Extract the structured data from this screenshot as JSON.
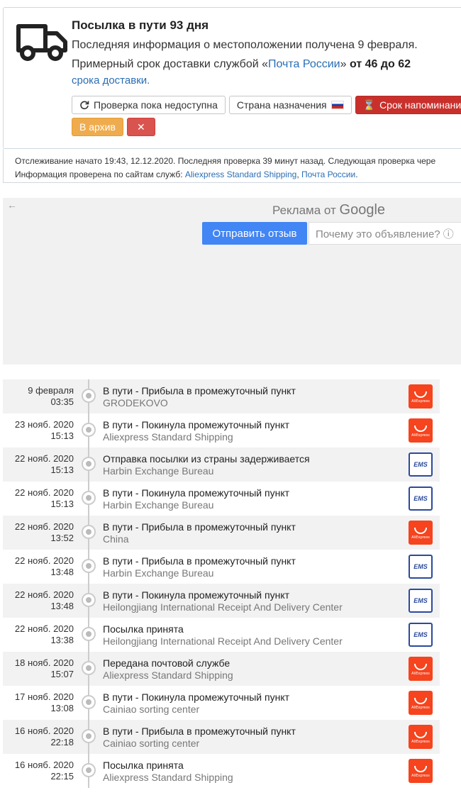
{
  "status": {
    "title": "Посылка в пути 93 дня",
    "line1": "Последняя информация о местоположении получена 9 февраля.",
    "line2_prefix": "Примерный срок доставки службой «",
    "line2_service": "Почта России",
    "line2_quote": "»",
    "line2_term": "от 46 до 62",
    "line3": "срока доставки.",
    "buttons": {
      "check": "Проверка пока недоступна",
      "country": "Страна назначения",
      "reminder": "Срок напоминания",
      "archive": "В архив",
      "delete": "✕"
    }
  },
  "info": {
    "line1": "Отслеживание начато 19:43, 12.12.2020. Последняя проверка 39 минут назад. Следующая проверка чере",
    "line2_prefix": "Информация проверена по сайтам служб: ",
    "service1": "Aliexpress Standard Shipping",
    "sep": ", ",
    "service2": "Почта России",
    "suffix": "."
  },
  "ad": {
    "back": "←",
    "label_prefix": "Реклама от ",
    "label_brand": "Google",
    "send_feedback": "Отправить отзыв",
    "why": "Почему это объявление? ⓘ"
  },
  "events": [
    {
      "date": "9 февраля",
      "time": "03:35",
      "title": "В пути - Прибыла в промежуточный пункт",
      "place": "GRODEKOVO",
      "logo": "aliexpress"
    },
    {
      "date": "23 нояб. 2020",
      "time": "15:13",
      "title": "В пути - Покинула промежуточный пункт",
      "place": "Aliexpress Standard Shipping",
      "logo": "aliexpress"
    },
    {
      "date": "22 нояб. 2020",
      "time": "15:13",
      "title": "Отправка посылки из страны задерживается",
      "place": "Harbin Exchange Bureau",
      "logo": "ems"
    },
    {
      "date": "22 нояб. 2020",
      "time": "15:13",
      "title": "В пути - Покинула промежуточный пункт",
      "place": "Harbin Exchange Bureau",
      "logo": "ems"
    },
    {
      "date": "22 нояб. 2020",
      "time": "13:52",
      "title": "В пути - Прибыла в промежуточный пункт",
      "place": "China",
      "logo": "aliexpress"
    },
    {
      "date": "22 нояб. 2020",
      "time": "13:48",
      "title": "В пути - Прибыла в промежуточный пункт",
      "place": "Harbin Exchange Bureau",
      "logo": "ems"
    },
    {
      "date": "22 нояб. 2020",
      "time": "13:48",
      "title": "В пути - Покинула промежуточный пункт",
      "place": "Heilongjiang International Receipt And Delivery Center",
      "logo": "ems"
    },
    {
      "date": "22 нояб. 2020",
      "time": "13:38",
      "title": "Посылка принята",
      "place": "Heilongjiang International Receipt And Delivery Center",
      "logo": "ems"
    },
    {
      "date": "18 нояб. 2020",
      "time": "15:07",
      "title": "Передана почтовой службе",
      "place": "Aliexpress Standard Shipping",
      "logo": "aliexpress"
    },
    {
      "date": "17 нояб. 2020",
      "time": "13:08",
      "title": "В пути - Покинула промежуточный пункт",
      "place": "Cainiao sorting center",
      "logo": "aliexpress"
    },
    {
      "date": "16 нояб. 2020",
      "time": "22:18",
      "title": "В пути - Прибыла в промежуточный пункт",
      "place": "Cainiao sorting center",
      "logo": "aliexpress"
    },
    {
      "date": "16 нояб. 2020",
      "time": "22:15",
      "title": "Посылка принята",
      "place": "Aliexpress Standard Shipping",
      "logo": "aliexpress"
    }
  ],
  "logos": {
    "aliexpress_text": "AliExpress",
    "ems_text": "EMS"
  }
}
